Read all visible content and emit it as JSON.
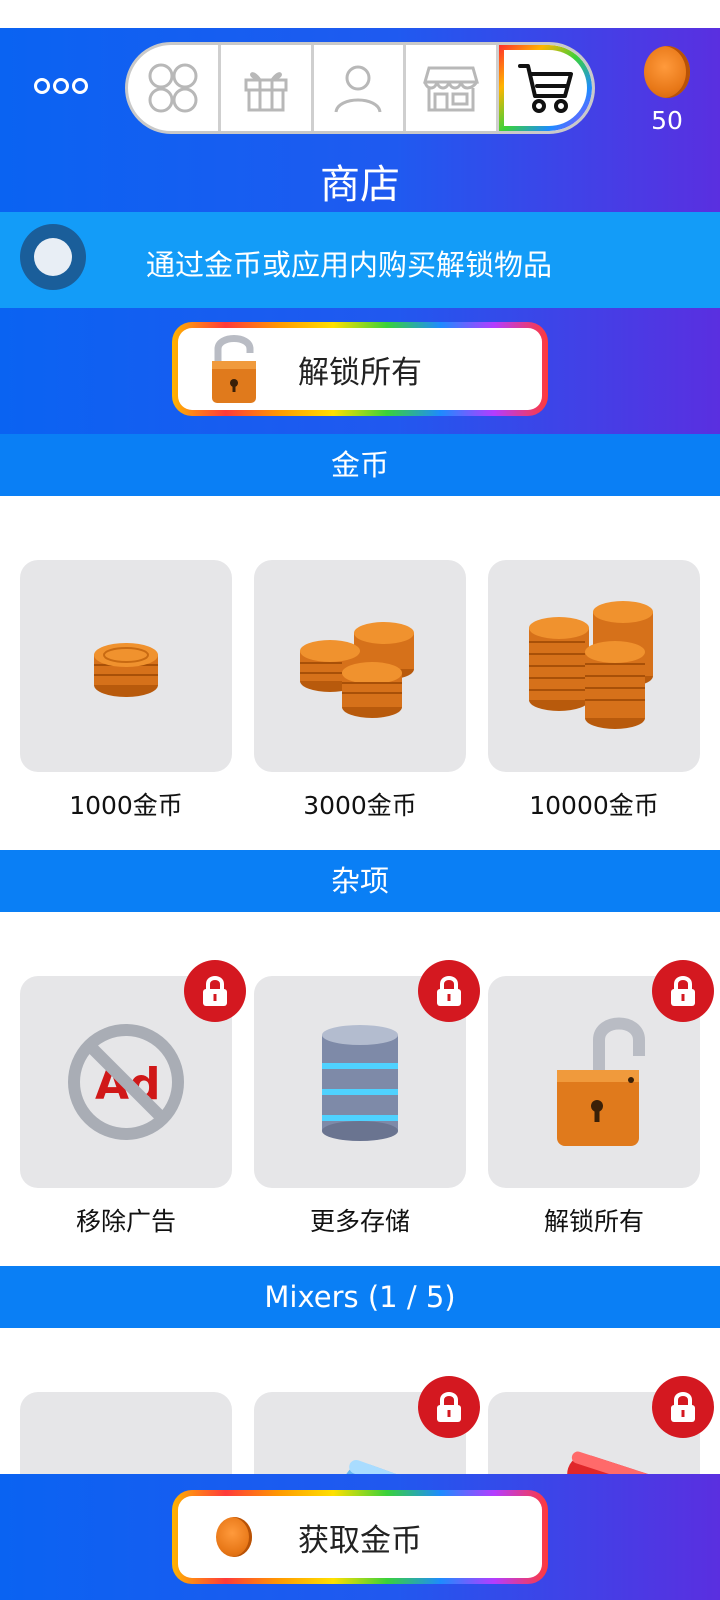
{
  "header": {
    "menu_icon": "three-dots-icon",
    "tabs": [
      {
        "icon": "grid-circles-icon"
      },
      {
        "icon": "gift-icon"
      },
      {
        "icon": "user-icon"
      },
      {
        "icon": "store-icon"
      },
      {
        "icon": "cart-icon",
        "active": true
      }
    ],
    "coin_count": "50",
    "title": "商店"
  },
  "info": {
    "text": "通过金币或应用内购买解锁物品"
  },
  "unlock_all_button": {
    "label": "解锁所有"
  },
  "sections": {
    "coins": {
      "title": "金币",
      "items": [
        {
          "label": "1000金币"
        },
        {
          "label": "3000金币"
        },
        {
          "label": "10000金币"
        }
      ]
    },
    "misc": {
      "title": "杂项",
      "items": [
        {
          "label": "移除广告",
          "locked": true
        },
        {
          "label": "更多存储",
          "locked": true
        },
        {
          "label": "解锁所有",
          "locked": true
        }
      ]
    },
    "mixers": {
      "title": "Mixers (1 / 5)",
      "items": [
        {
          "locked": false
        },
        {
          "locked": true
        },
        {
          "locked": true
        }
      ]
    }
  },
  "bottom_button": {
    "label": "获取金币"
  },
  "colors": {
    "header_start": "#0a63f2",
    "header_end": "#5a2fe0",
    "section": "#0a7ff5",
    "info_bar": "#139cf8",
    "lock_badge": "#d41820",
    "coin": "#e87818"
  }
}
